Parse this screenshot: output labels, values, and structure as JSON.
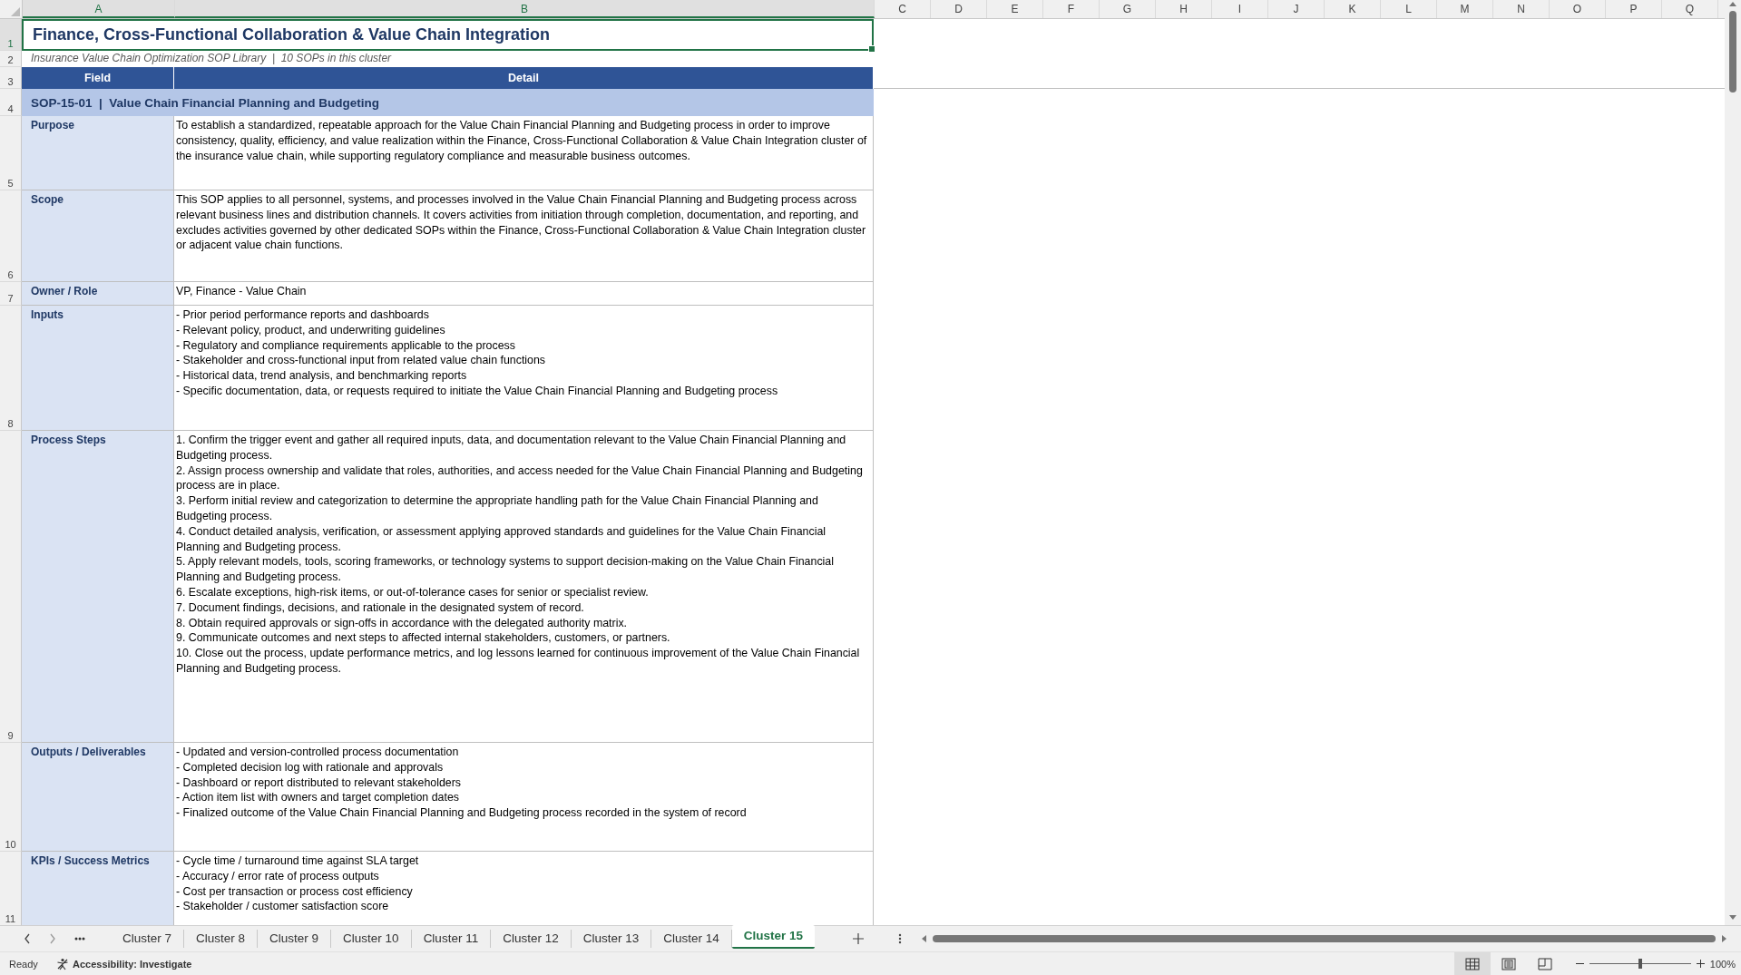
{
  "column_headers": [
    {
      "label": "A",
      "selected": true
    },
    {
      "label": "B",
      "selected": true
    },
    {
      "label": "C",
      "selected": false
    },
    {
      "label": "D",
      "selected": false
    },
    {
      "label": "E",
      "selected": false
    },
    {
      "label": "F",
      "selected": false
    },
    {
      "label": "G",
      "selected": false
    },
    {
      "label": "H",
      "selected": false
    },
    {
      "label": "I",
      "selected": false
    },
    {
      "label": "J",
      "selected": false
    },
    {
      "label": "K",
      "selected": false
    },
    {
      "label": "L",
      "selected": false
    },
    {
      "label": "M",
      "selected": false
    },
    {
      "label": "N",
      "selected": false
    },
    {
      "label": "O",
      "selected": false
    },
    {
      "label": "P",
      "selected": false
    },
    {
      "label": "Q",
      "selected": false
    }
  ],
  "row_numbers": [
    {
      "label": "1",
      "selected": true
    },
    {
      "label": "2",
      "selected": false
    },
    {
      "label": "3",
      "selected": false
    },
    {
      "label": "4",
      "selected": false
    },
    {
      "label": "5",
      "selected": false
    },
    {
      "label": "6",
      "selected": false
    },
    {
      "label": "7",
      "selected": false
    },
    {
      "label": "8",
      "selected": false
    },
    {
      "label": "9",
      "selected": false
    },
    {
      "label": "10",
      "selected": false
    },
    {
      "label": "11",
      "selected": false
    }
  ],
  "title": "Finance, Cross-Functional Collaboration & Value Chain Integration",
  "subtitle": "Insurance Value Chain Optimization SOP Library  |  10 SOPs in this cluster",
  "table": {
    "columns": [
      "Field",
      "Detail"
    ],
    "section": "SOP-15-01  |  Value Chain Financial Planning and Budgeting",
    "rows": [
      {
        "field": "Purpose",
        "detail": "To establish a standardized, repeatable approach for the Value Chain Financial Planning and Budgeting process in order to improve consistency, quality, efficiency, and value realization within the Finance, Cross-Functional Collaboration & Value Chain Integration cluster of the insurance value chain, while supporting regulatory compliance and measurable business outcomes."
      },
      {
        "field": "Scope",
        "detail": "This SOP applies to all personnel, systems, and processes involved in the Value Chain Financial Planning and Budgeting process across relevant business lines and distribution channels. It covers activities from initiation through completion, documentation, and reporting, and excludes activities governed by other dedicated SOPs within the Finance, Cross-Functional Collaboration & Value Chain Integration cluster or adjacent value chain functions."
      },
      {
        "field": "Owner / Role",
        "detail": "VP, Finance - Value Chain"
      },
      {
        "field": "Inputs",
        "detail": "- Prior period performance reports and dashboards\n- Relevant policy, product, and underwriting guidelines\n- Regulatory and compliance requirements applicable to the process\n- Stakeholder and cross-functional input from related value chain functions\n- Historical data, trend analysis, and benchmarking reports\n- Specific documentation, data, or requests required to initiate the Value Chain Financial Planning and Budgeting process"
      },
      {
        "field": "Process Steps",
        "detail": "1. Confirm the trigger event and gather all required inputs, data, and documentation relevant to the Value Chain Financial Planning and Budgeting process.\n2. Assign process ownership and validate that roles, authorities, and access needed for the Value Chain Financial Planning and Budgeting process are in place.\n3. Perform initial review and categorization to determine the appropriate handling path for the Value Chain Financial Planning and Budgeting process.\n4. Conduct detailed analysis, verification, or assessment applying approved standards and guidelines for the Value Chain Financial Planning and Budgeting process.\n5. Apply relevant models, tools, scoring frameworks, or technology systems to support decision-making on the Value Chain Financial Planning and Budgeting process.\n6. Escalate exceptions, high-risk items, or out-of-tolerance cases for senior or specialist review.\n7. Document findings, decisions, and rationale in the designated system of record.\n8. Obtain required approvals or sign-offs in accordance with the delegated authority matrix.\n9. Communicate outcomes and next steps to affected internal stakeholders, customers, or partners.\n10. Close out the process, update performance metrics, and log lessons learned for continuous improvement of the Value Chain Financial Planning and Budgeting process."
      },
      {
        "field": "Outputs / Deliverables",
        "detail": "- Updated and version-controlled process documentation\n- Completed decision log with rationale and approvals\n- Dashboard or report distributed to relevant stakeholders\n- Action item list with owners and target completion dates\n- Finalized outcome of the Value Chain Financial Planning and Budgeting process recorded in the system of record"
      },
      {
        "field": "KPIs / Success Metrics",
        "detail": "- Cycle time / turnaround time against SLA target\n- Accuracy / error rate of process outputs\n- Cost per transaction or process cost efficiency\n- Stakeholder / customer satisfaction score"
      }
    ]
  },
  "sheet_tabs": [
    {
      "label": "Cluster 7",
      "selected": false
    },
    {
      "label": "Cluster 8",
      "selected": false
    },
    {
      "label": "Cluster 9",
      "selected": false
    },
    {
      "label": "Cluster 10",
      "selected": false
    },
    {
      "label": "Cluster 11",
      "selected": false
    },
    {
      "label": "Cluster 12",
      "selected": false
    },
    {
      "label": "Cluster 13",
      "selected": false
    },
    {
      "label": "Cluster 14",
      "selected": false
    },
    {
      "label": "Cluster 15",
      "selected": true
    }
  ],
  "status_bar": {
    "status": "Ready",
    "accessibility": "Accessibility: Investigate",
    "views": [
      {
        "kind": "normal",
        "selected": true
      },
      {
        "kind": "page_layout",
        "selected": false
      },
      {
        "kind": "page_break",
        "selected": false
      }
    ],
    "zoom": {
      "level": 0.5,
      "reading": "100%"
    }
  }
}
